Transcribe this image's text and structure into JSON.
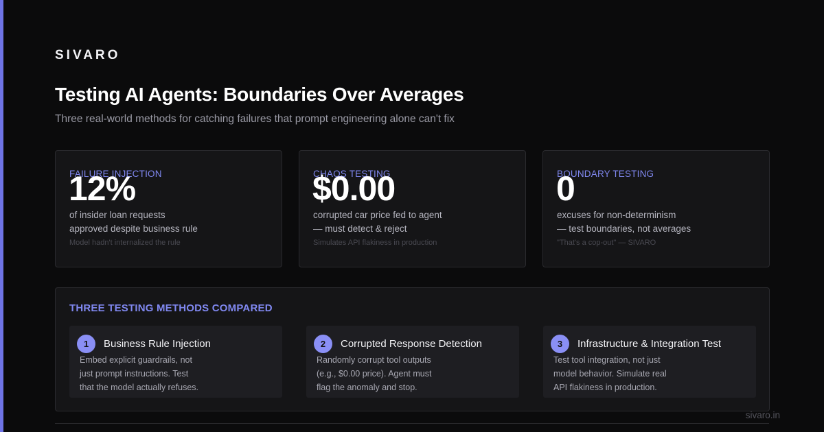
{
  "brand": "SIVARO",
  "title": "Testing AI Agents: Boundaries Over Averages",
  "subtitle": "Three real-world methods for catching failures that prompt engineering alone can't fix",
  "accent_color": "#6f74e6",
  "stats": [
    {
      "label": "Failure Injection",
      "value": "12%",
      "desc_line1": "of insider loan requests",
      "desc_line2": "approved despite business rule",
      "note": "Model hadn't internalized the rule"
    },
    {
      "label": "Chaos Testing",
      "value": "$0.00",
      "desc_line1": "corrupted car price fed to agent",
      "desc_line2": "— must detect & reject",
      "note": "Simulates API flakiness in production"
    },
    {
      "label": "Boundary Testing",
      "value": "0",
      "desc_line1": "excuses for non-determinism",
      "desc_line2": "— test boundaries, not averages",
      "note": "\"That's a cop-out\" — SIVARO"
    }
  ],
  "methods": {
    "heading": "Three Testing Methods Compared",
    "items": [
      {
        "num": "1",
        "title": "Business Rule Injection",
        "lines": [
          "Embed explicit guardrails, not",
          "just prompt instructions. Test",
          "that the model actually refuses."
        ]
      },
      {
        "num": "2",
        "title": "Corrupted Response Detection",
        "lines": [
          "Randomly corrupt tool outputs",
          "(e.g., $0.00 price). Agent must",
          "flag the anomaly and stop."
        ]
      },
      {
        "num": "3",
        "title": "Infrastructure & Integration Test",
        "lines": [
          "Test tool integration, not just",
          "model behavior. Simulate real",
          "API flakiness in production."
        ]
      }
    ]
  },
  "footer": {
    "domain": "sivaro.in"
  }
}
